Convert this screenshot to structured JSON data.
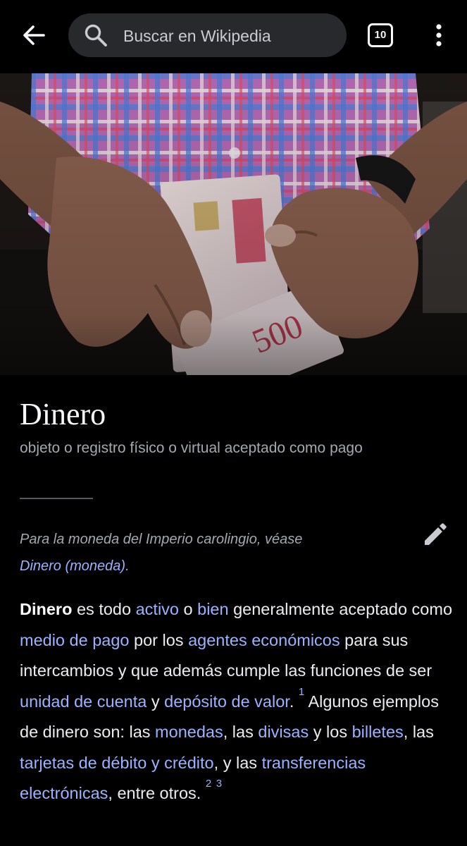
{
  "search": {
    "placeholder": "Buscar en Wikipedia"
  },
  "tabs": {
    "count": "10"
  },
  "article": {
    "title": "Dinero",
    "description": "objeto o registro físico o virtual aceptado como pago",
    "hatnote": {
      "text": "Para la moneda del Imperio carolingio, véase",
      "link": "Dinero (moneda)",
      "end": "."
    },
    "body": [
      {
        "t": "b",
        "v": "Dinero"
      },
      {
        "t": "t",
        "v": " es todo "
      },
      {
        "t": "a",
        "v": "activo"
      },
      {
        "t": "t",
        "v": " o "
      },
      {
        "t": "a",
        "v": "bien"
      },
      {
        "t": "t",
        "v": " generalmente aceptado como "
      },
      {
        "t": "a",
        "v": "medio de pago"
      },
      {
        "t": "t",
        "v": " por los "
      },
      {
        "t": "a",
        "v": "agentes económicos"
      },
      {
        "t": "t",
        "v": " para sus intercambios y que además cumple las funciones de ser "
      },
      {
        "t": "a",
        "v": "unidad de cuenta"
      },
      {
        "t": "t",
        "v": " y "
      },
      {
        "t": "a",
        "v": "depósito de valor"
      },
      {
        "t": "t",
        "v": ". "
      },
      {
        "t": "sup",
        "v": "1"
      },
      {
        "t": "t",
        "v": " Algunos ejemplos de dinero son: las "
      },
      {
        "t": "a",
        "v": "monedas"
      },
      {
        "t": "t",
        "v": ", las "
      },
      {
        "t": "a",
        "v": "divisas"
      },
      {
        "t": "t",
        "v": " y los "
      },
      {
        "t": "a",
        "v": "billetes"
      },
      {
        "t": "t",
        "v": ", las "
      },
      {
        "t": "a",
        "v": "tarjetas de débito y crédito"
      },
      {
        "t": "t",
        "v": ", y las "
      },
      {
        "t": "a",
        "v": "transferencias electrónicas"
      },
      {
        "t": "t",
        "v": ", entre otros. "
      },
      {
        "t": "sup",
        "v": "2"
      },
      {
        "t": "t",
        "v": " "
      },
      {
        "t": "sup",
        "v": "3"
      }
    ]
  },
  "colors": {
    "background": "#000000",
    "link": "#9cb2ff",
    "text": "#eaecf0",
    "muted": "#a2a9b1"
  }
}
